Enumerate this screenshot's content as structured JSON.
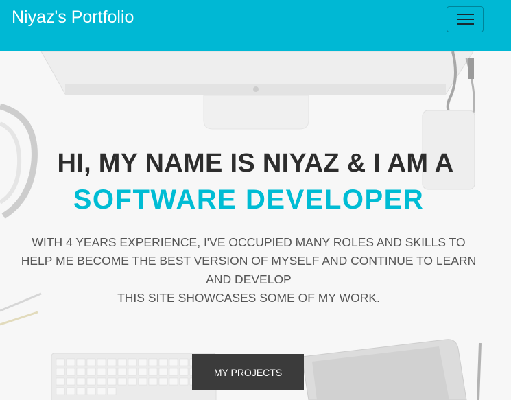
{
  "navbar": {
    "brand": "Niyaz's Portfolio",
    "toggle_icon": "hamburger-menu-icon"
  },
  "hero": {
    "headline": "HI, MY NAME IS NIYAZ & I AM A",
    "subheadline": "SOFTWARE DEVELOPER",
    "description_lines": [
      "WITH 4 YEARS EXPERIENCE, I'VE OCCUPIED MANY ROLES AND SKILLS TO",
      "HELP ME BECOME THE BEST VERSION OF MYSELF AND CONTINUE TO LEARN",
      "AND DEVELOP",
      "THIS SITE SHOWCASES SOME OF MY WORK."
    ],
    "cta_label": "MY PROJECTS"
  },
  "colors": {
    "navbar_bg": "#00b8d4",
    "accent": "#00bcd4",
    "headline_text": "#2d2d2d",
    "button_bg": "#3b3b3b"
  }
}
